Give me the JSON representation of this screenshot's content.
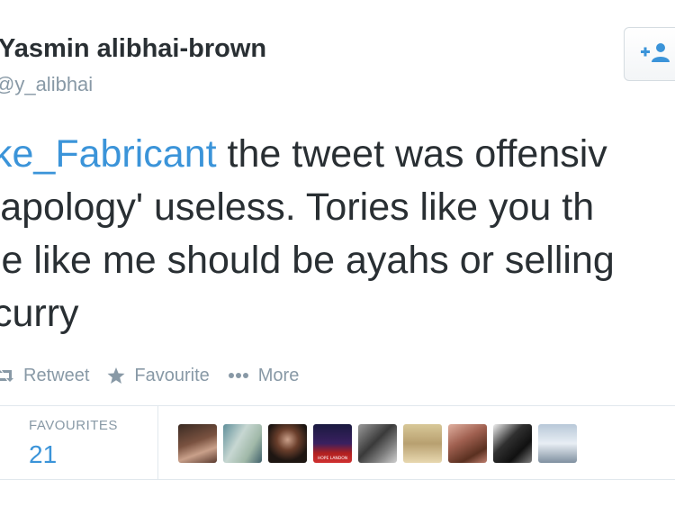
{
  "author": {
    "name": "Yasmin alibhai-brown",
    "handle": "@y_alibhai"
  },
  "follow_button": {
    "icon": "follow-person-plus-icon"
  },
  "tweet": {
    "lines": [
      {
        "mention": "ke_Fabricant",
        "text": " the tweet was offensiv"
      },
      {
        "text": "'apology' useless. Tories like you th"
      },
      {
        "text": "le like me should be ayahs or selling"
      },
      {
        "text": "curry"
      }
    ]
  },
  "actions": {
    "retweet": {
      "label": "Retweet",
      "icon": "retweet-icon"
    },
    "favourite": {
      "label": "Favourite",
      "icon": "star-icon"
    },
    "more": {
      "label": "More",
      "icon": "more-dots-icon"
    }
  },
  "stats": {
    "favourites_label": "FAVOURITES",
    "favourites_count": "21"
  },
  "favoriters": [
    {
      "name": "favoriter-avatar-1"
    },
    {
      "name": "favoriter-avatar-2"
    },
    {
      "name": "favoriter-avatar-3"
    },
    {
      "name": "favoriter-avatar-4",
      "caption": "HOPE LANDON"
    },
    {
      "name": "favoriter-avatar-5"
    },
    {
      "name": "favoriter-avatar-6"
    },
    {
      "name": "favoriter-avatar-7"
    },
    {
      "name": "favoriter-avatar-8"
    },
    {
      "name": "favoriter-avatar-9"
    }
  ],
  "colors": {
    "text": "#292f33",
    "muted": "#8899a6",
    "link": "#3b94d9",
    "divider": "#e1e8ed"
  }
}
